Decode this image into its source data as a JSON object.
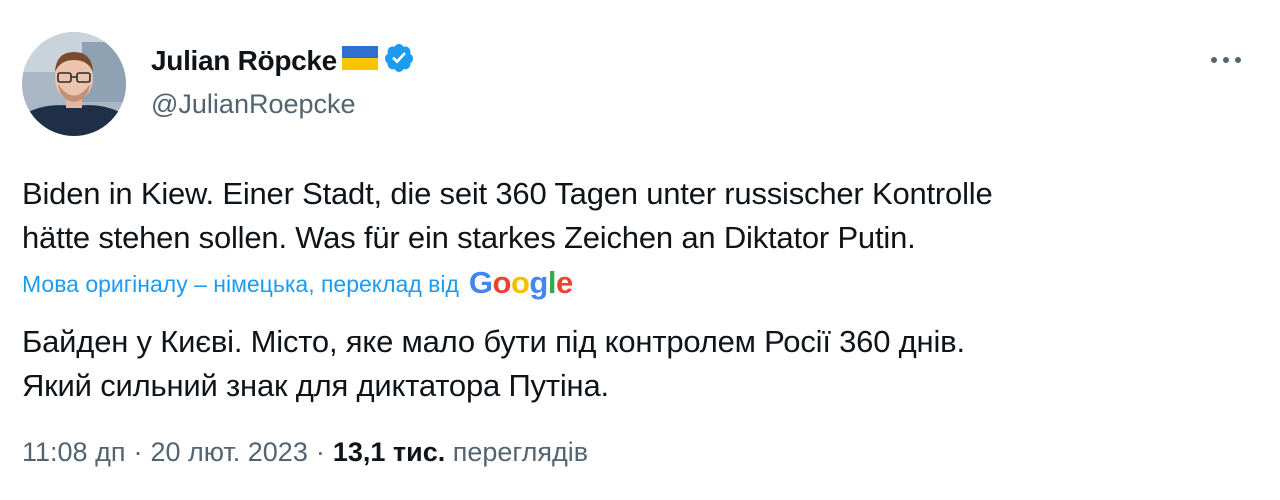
{
  "author": {
    "display_name": "Julian Röpcke",
    "handle": "@JulianRoepcke",
    "verified": true,
    "flag": "ukraine-flag"
  },
  "tweet": {
    "lines": [
      "Biden in Kiew. Einer Stadt, die seit 360 Tagen unter russischer Kontrolle",
      "hätte stehen sollen. Was für ein starkes Zeichen an Diktator Putin."
    ]
  },
  "translation": {
    "label": "Мова оригіналу – німецька, переклад від",
    "provider": [
      "G",
      "o",
      "o",
      "g",
      "l",
      "e"
    ],
    "provider_colors": [
      "#4285F4",
      "#EA4335",
      "#FBBC05",
      "#4285F4",
      "#34A853",
      "#EA4335"
    ],
    "lines": [
      "Байден у Києві. Місто, яке мало бути під контролем Росії 360 днів.",
      "Який сильний знак для диктатора Путіна."
    ]
  },
  "meta": {
    "time": "11:08 дп",
    "separator": "·",
    "date": "20 лют. 2023",
    "views_count": "13,1 тис.",
    "views_label": "переглядів"
  },
  "colors": {
    "link": "#1d9bf0",
    "secondary": "#536471",
    "verified": "#1d9bf0"
  },
  "icons": {
    "more": "more-horizontal-icon",
    "verified": "verified-badge-icon"
  }
}
